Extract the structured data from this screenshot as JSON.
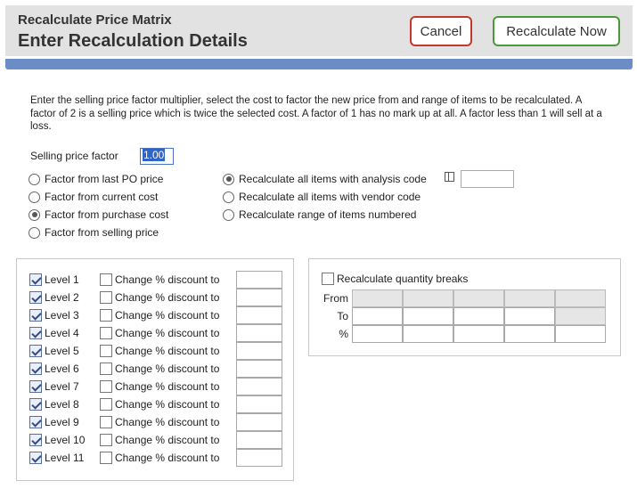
{
  "header": {
    "subtitle": "Recalculate Price Matrix",
    "title": "Enter Recalculation Details",
    "cancel_label": "Cancel",
    "recalc_label": "Recalculate Now"
  },
  "intro_text": "Enter the selling price factor multiplier, select the cost to factor the new price from and range of items to be recalculated. A factor of 2 is a selling price which is twice the selected cost. A factor of 1 has no mark up at all. A factor less than 1 will sell at a loss.",
  "selling_price_factor": {
    "label": "Selling price factor",
    "value": "1.00"
  },
  "factor_options": [
    {
      "label": "Factor from last PO price",
      "selected": false
    },
    {
      "label": "Factor from current cost",
      "selected": false
    },
    {
      "label": "Factor from purchase cost",
      "selected": true
    },
    {
      "label": "Factor from selling price",
      "selected": false
    }
  ],
  "recalc_options": [
    {
      "label": "Recalculate all items with analysis code",
      "selected": true
    },
    {
      "label": "Recalculate all items with vendor code",
      "selected": false
    },
    {
      "label": "Recalculate range of items numbered",
      "selected": false
    }
  ],
  "analysis_code": {
    "icon": "code-lookup-icon",
    "value": ""
  },
  "levels": [
    {
      "label": "Level 1",
      "checked": true,
      "disc_label": "Change % discount to",
      "disc_checked": false,
      "value": ""
    },
    {
      "label": "Level 2",
      "checked": true,
      "disc_label": "Change % discount to",
      "disc_checked": false,
      "value": ""
    },
    {
      "label": "Level 3",
      "checked": true,
      "disc_label": "Change % discount to",
      "disc_checked": false,
      "value": ""
    },
    {
      "label": "Level 4",
      "checked": true,
      "disc_label": "Change % discount to",
      "disc_checked": false,
      "value": ""
    },
    {
      "label": "Level 5",
      "checked": true,
      "disc_label": "Change % discount to",
      "disc_checked": false,
      "value": ""
    },
    {
      "label": "Level 6",
      "checked": true,
      "disc_label": "Change % discount to",
      "disc_checked": false,
      "value": ""
    },
    {
      "label": "Level 7",
      "checked": true,
      "disc_label": "Change % discount to",
      "disc_checked": false,
      "value": ""
    },
    {
      "label": "Level 8",
      "checked": true,
      "disc_label": "Change % discount to",
      "disc_checked": false,
      "value": ""
    },
    {
      "label": "Level 9",
      "checked": true,
      "disc_label": "Change % discount to",
      "disc_checked": false,
      "value": ""
    },
    {
      "label": "Level 10",
      "checked": true,
      "disc_label": "Change % discount to",
      "disc_checked": false,
      "value": ""
    },
    {
      "label": "Level 11",
      "checked": true,
      "disc_label": "Change % discount to",
      "disc_checked": false,
      "value": ""
    }
  ],
  "quantity_breaks": {
    "label": "Recalculate quantity breaks",
    "checked": false,
    "rows": [
      {
        "label": "From",
        "cells": [
          "",
          "",
          "",
          "",
          ""
        ],
        "disabled": [
          true,
          true,
          true,
          true,
          true
        ]
      },
      {
        "label": "To",
        "cells": [
          "",
          "",
          "",
          "",
          ""
        ],
        "disabled": [
          false,
          false,
          false,
          false,
          true
        ]
      },
      {
        "label": "%",
        "cells": [
          "",
          "",
          "",
          "",
          ""
        ],
        "disabled": [
          false,
          false,
          false,
          false,
          false
        ]
      }
    ]
  },
  "colors": {
    "accent_bar": "#6c8cc7",
    "cancel_border": "#c0392b",
    "recalc_border": "#4a9a3a"
  }
}
